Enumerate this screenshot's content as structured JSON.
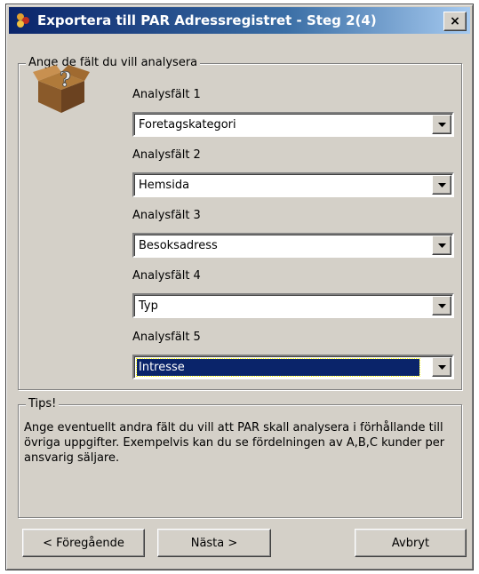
{
  "window": {
    "title": "Exportera till PAR Adressregistret - Steg 2(4)",
    "close_label": "×"
  },
  "group_fields": {
    "legend": "Ange de fält du vill analysera",
    "fields": [
      {
        "label": "Analysfält 1",
        "value": "Foretagskategori"
      },
      {
        "label": "Analysfält 2",
        "value": "Hemsida"
      },
      {
        "label": "Analysfält 3",
        "value": "Besoksadress"
      },
      {
        "label": "Analysfält 4",
        "value": "Typ"
      },
      {
        "label": "Analysfält 5",
        "value": "Intresse",
        "selected": true
      }
    ]
  },
  "tips": {
    "legend": "Tips!",
    "text": "Ange eventuellt andra fält du vill att PAR skall analysera i förhållande till övriga uppgifter. Exempelvis kan du se fördelningen av A,B,C kunder per ansvarig säljare."
  },
  "buttons": {
    "prev_label": "< Föregående",
    "next_label": "Nästa >",
    "cancel_label": "Avbryt"
  },
  "icons": {
    "app": "par-app-icon",
    "box": "box-question-icon",
    "dropdown": "chevron-down-icon"
  },
  "colors": {
    "title_start": "#0a246a",
    "title_end": "#a6caf0",
    "selection": "#0a246a",
    "dialog_bg": "#d4d0c8"
  }
}
